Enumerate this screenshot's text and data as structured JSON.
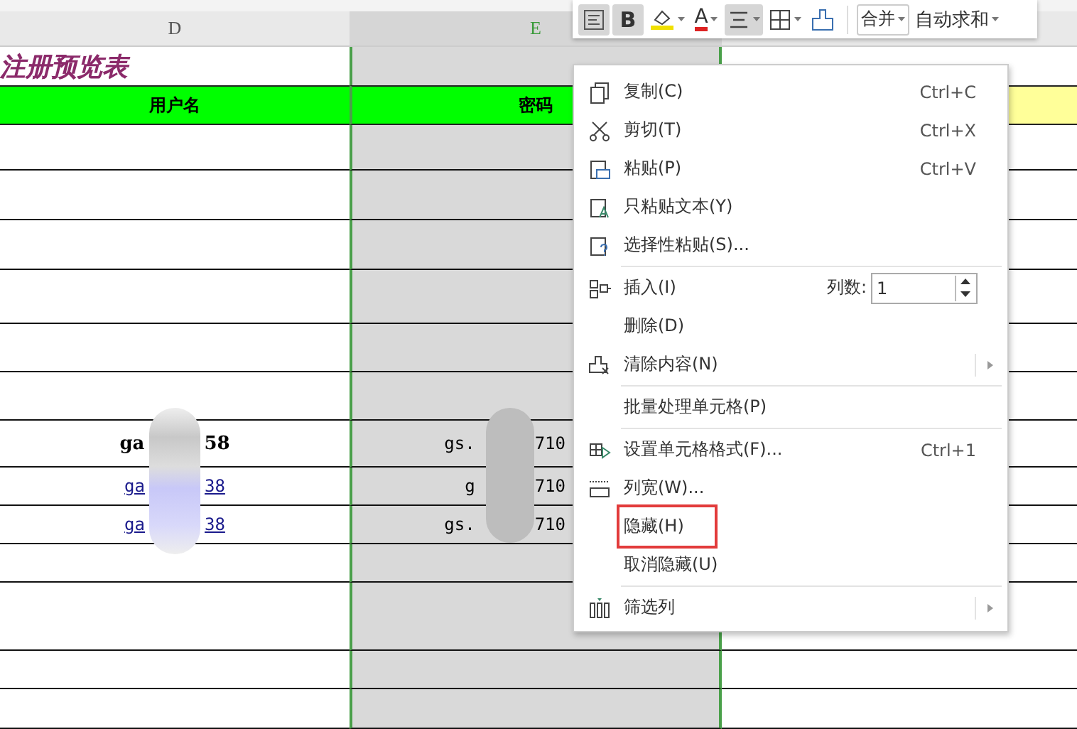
{
  "toolbar": {
    "buttons": [
      {
        "kind": "wrap",
        "selected": true
      },
      {
        "kind": "bold",
        "selected": true,
        "label": "B"
      },
      {
        "kind": "fill",
        "selected": false
      },
      {
        "kind": "font-color",
        "selected": false,
        "label": "A"
      },
      {
        "kind": "align",
        "selected": true
      },
      {
        "kind": "borders",
        "selected": false
      },
      {
        "kind": "painter",
        "selected": false
      }
    ],
    "merge": "合并",
    "autosum": "自动求和"
  },
  "column_headers": [
    {
      "label": "D",
      "selected": false
    },
    {
      "label": "E",
      "selected": true
    }
  ],
  "title": "注册预览表",
  "table": {
    "columns": [
      "用户名",
      "密码"
    ],
    "rows": [
      {
        "kind": "empty"
      },
      {
        "kind": "empty"
      },
      {
        "kind": "empty"
      },
      {
        "kind": "empty"
      },
      {
        "kind": "empty"
      },
      {
        "kind": "empty"
      },
      {
        "kind": "bold",
        "username": [
          "ga",
          "58"
        ],
        "password": [
          "gs.",
          "710"
        ]
      },
      {
        "kind": "link",
        "username": [
          "ga",
          "38"
        ],
        "password": [
          "g",
          "710"
        ]
      },
      {
        "kind": "link",
        "username": [
          "ga",
          "38"
        ],
        "password": [
          "gs.",
          "710"
        ]
      },
      {
        "kind": "empty"
      },
      {
        "kind": "empty"
      },
      {
        "kind": "empty"
      },
      {
        "kind": "empty"
      }
    ]
  },
  "context_menu": {
    "items": [
      {
        "kind": "copy",
        "label": "复制(C)",
        "shortcut": "Ctrl+C",
        "highlighted": false
      },
      {
        "kind": "cut",
        "label": "剪切(T)",
        "shortcut": "Ctrl+X",
        "highlighted": false
      },
      {
        "kind": "paste",
        "label": "粘贴(P)",
        "shortcut": "Ctrl+V",
        "highlighted": false
      },
      {
        "kind": "paste-text",
        "label": "只粘贴文本(Y)",
        "highlighted": false
      },
      {
        "kind": "paste-special",
        "label": "选择性粘贴(S)...",
        "highlighted": false
      },
      {
        "kind": "separator"
      },
      {
        "kind": "insert",
        "label": "插入(I)",
        "count_label": "列数:",
        "count_value": "1",
        "highlighted": false
      },
      {
        "kind": "plain",
        "label": "删除(D)",
        "highlighted": false
      },
      {
        "kind": "clear",
        "label": "清除内容(N)",
        "submenu": true,
        "highlighted": false
      },
      {
        "kind": "separator"
      },
      {
        "kind": "plain",
        "label": "批量处理单元格(P)",
        "highlighted": false
      },
      {
        "kind": "separator"
      },
      {
        "kind": "format",
        "label": "设置单元格格式(F)...",
        "shortcut": "Ctrl+1",
        "highlighted": false
      },
      {
        "kind": "width",
        "label": "列宽(W)...",
        "highlighted": false
      },
      {
        "kind": "plain",
        "label": "隐藏(H)",
        "highlighted": true
      },
      {
        "kind": "plain",
        "label": "取消隐藏(U)",
        "highlighted": false
      },
      {
        "kind": "separator"
      },
      {
        "kind": "filter",
        "label": "筛选列",
        "submenu": true,
        "highlighted": false
      }
    ]
  }
}
